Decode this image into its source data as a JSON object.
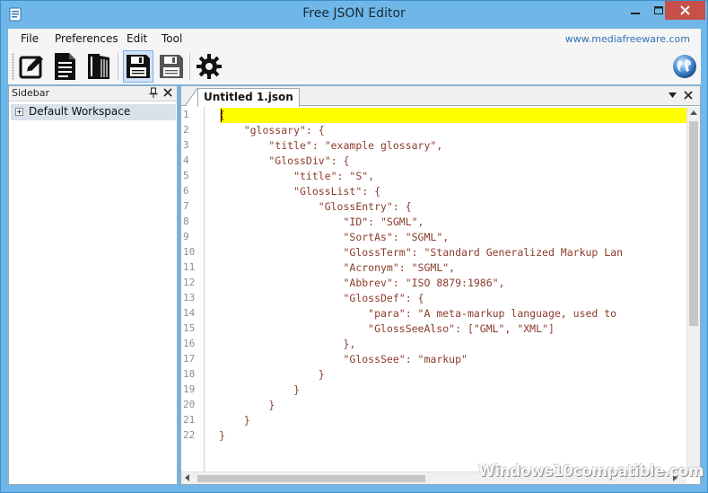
{
  "window": {
    "title": "Free JSON Editor",
    "accent_color": "#6fb7e9",
    "close_color": "#c7504a"
  },
  "menu": {
    "items": [
      "File",
      "Preferences",
      "Edit",
      "Tool"
    ],
    "link": "www.mediafreeware.com"
  },
  "toolbar": {
    "buttons": [
      "edit-icon",
      "document-icon",
      "book-icon",
      "save-icon",
      "save-as-icon",
      "settings-icon"
    ],
    "pressed": "save-icon",
    "right_icon": "globe-icon"
  },
  "sidebar": {
    "title": "Sidebar",
    "items": [
      {
        "label": "Default Workspace"
      }
    ]
  },
  "editor": {
    "tab_label": "Untitled 1.json",
    "current_line": 1,
    "highlight_color": "#ffff00",
    "line_numbers": [
      "1",
      "2",
      "3",
      "4",
      "5",
      "6",
      "7",
      "8",
      "9",
      "10",
      "11",
      "12",
      "13",
      "14",
      "15",
      "16",
      "17",
      "18",
      "19",
      "20",
      "21",
      "22"
    ],
    "lines": [
      "{",
      "    \"glossary\": {",
      "        \"title\": \"example glossary\",",
      "        \"GlossDiv\": {",
      "            \"title\": \"S\",",
      "            \"GlossList\": {",
      "                \"GlossEntry\": {",
      "                    \"ID\": \"SGML\",",
      "                    \"SortAs\": \"SGML\",",
      "                    \"GlossTerm\": \"Standard Generalized Markup Lan",
      "                    \"Acronym\": \"SGML\",",
      "                    \"Abbrev\": \"ISO 8879:1986\",",
      "                    \"GlossDef\": {",
      "                        \"para\": \"A meta-markup language, used to",
      "                        \"GlossSeeAlso\": [\"GML\", \"XML\"]",
      "                    },",
      "                    \"GlossSee\": \"markup\"",
      "                }",
      "            }",
      "        }",
      "    }",
      "}"
    ]
  },
  "watermark": "Windows10compatible.com"
}
